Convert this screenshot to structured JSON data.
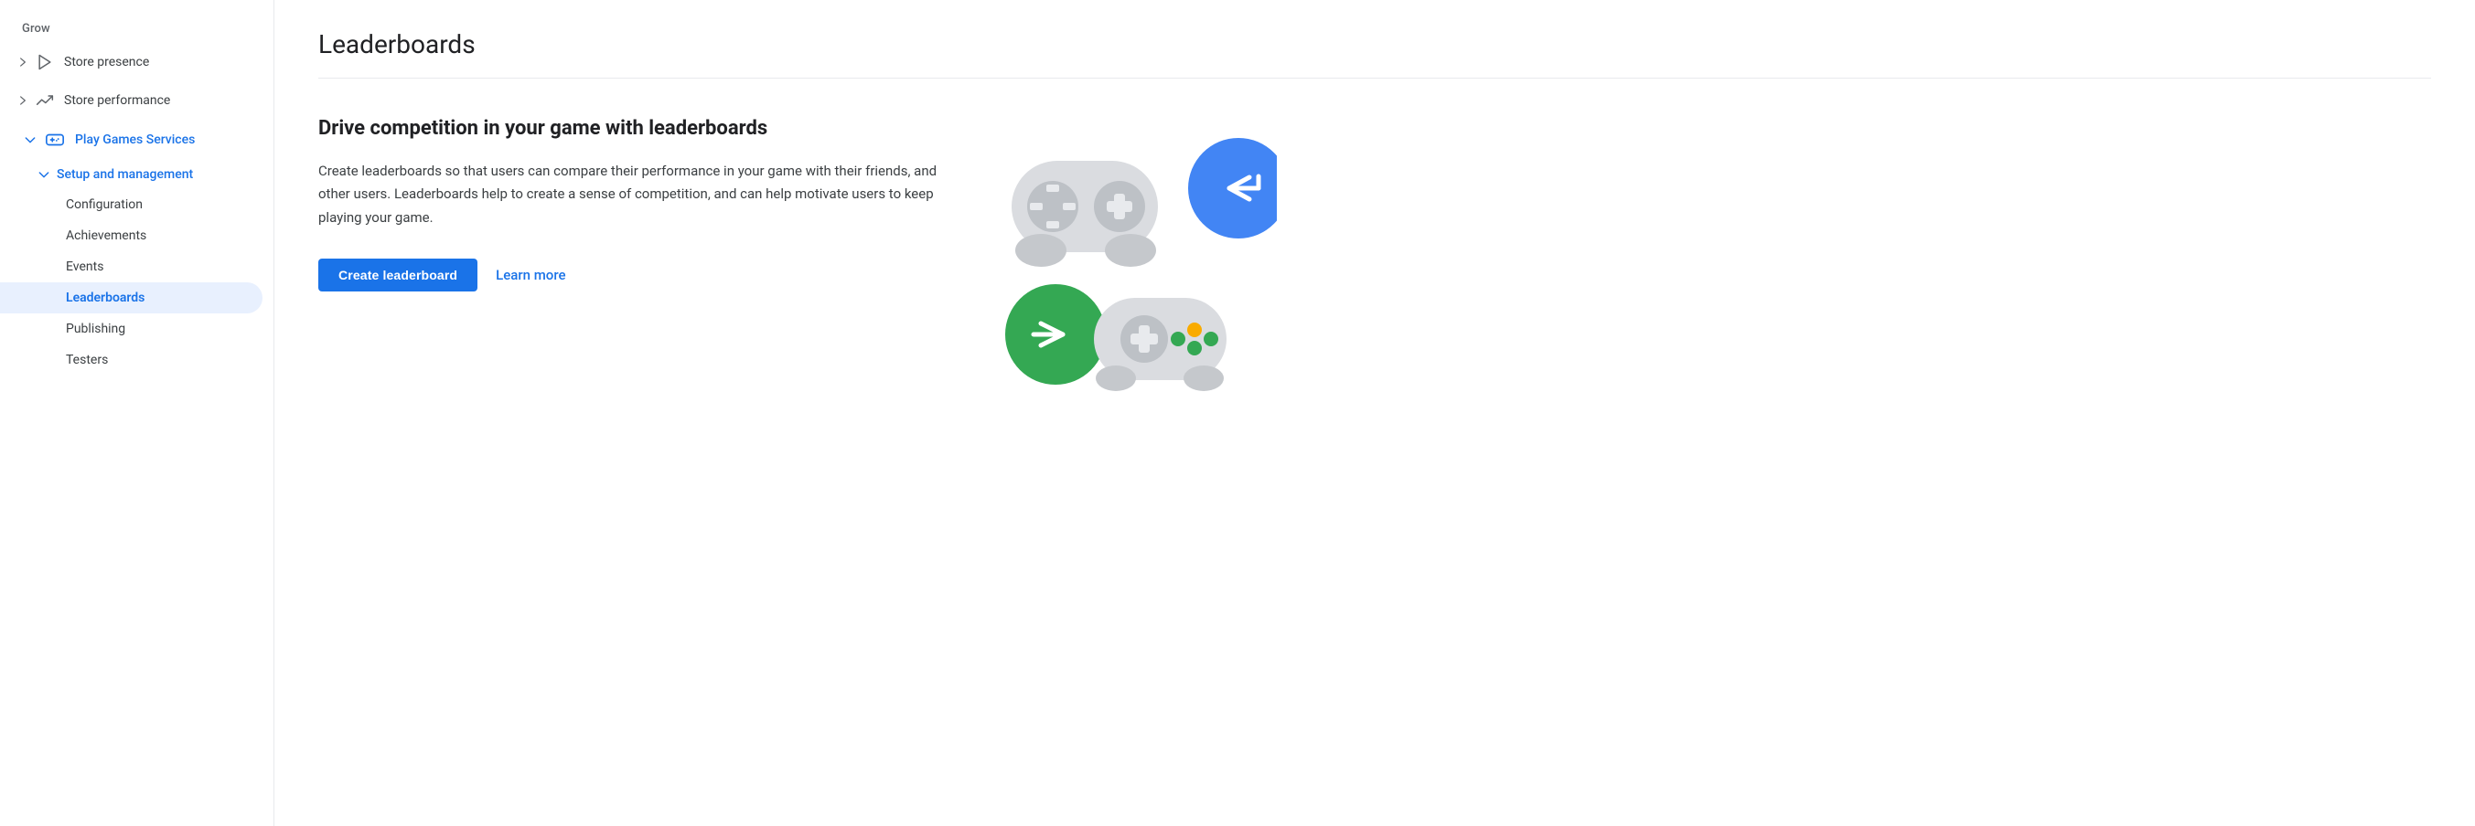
{
  "sidebar": {
    "section_label": "Grow",
    "items": [
      {
        "id": "store-presence",
        "label": "Store presence",
        "icon": "play-icon",
        "arrow": "right",
        "active": false
      },
      {
        "id": "store-performance",
        "label": "Store performance",
        "icon": "trending-icon",
        "arrow": "right",
        "active": false
      },
      {
        "id": "play-games-services",
        "label": "Play Games Services",
        "icon": "gamepad-icon",
        "arrow": "down",
        "active": true
      },
      {
        "id": "setup-and-management",
        "label": "Setup and management",
        "sub": true,
        "arrow": "down",
        "active": true
      },
      {
        "id": "configuration",
        "label": "Configuration",
        "sub2": true
      },
      {
        "id": "achievements",
        "label": "Achievements",
        "sub2": true
      },
      {
        "id": "events",
        "label": "Events",
        "sub2": true
      },
      {
        "id": "leaderboards",
        "label": "Leaderboards",
        "sub2": true,
        "active": true
      },
      {
        "id": "publishing",
        "label": "Publishing",
        "sub2": true
      },
      {
        "id": "testers",
        "label": "Testers",
        "sub2": true
      }
    ]
  },
  "main": {
    "title": "Leaderboards",
    "heading": "Drive competition in your game with leaderboards",
    "body": "Create leaderboards so that users can compare their performance in your game with their friends, and other users. Leaderboards help to create a sense of competition, and can help motivate users to keep playing your game.",
    "create_button": "Create leaderboard",
    "learn_more_label": "Learn more"
  }
}
